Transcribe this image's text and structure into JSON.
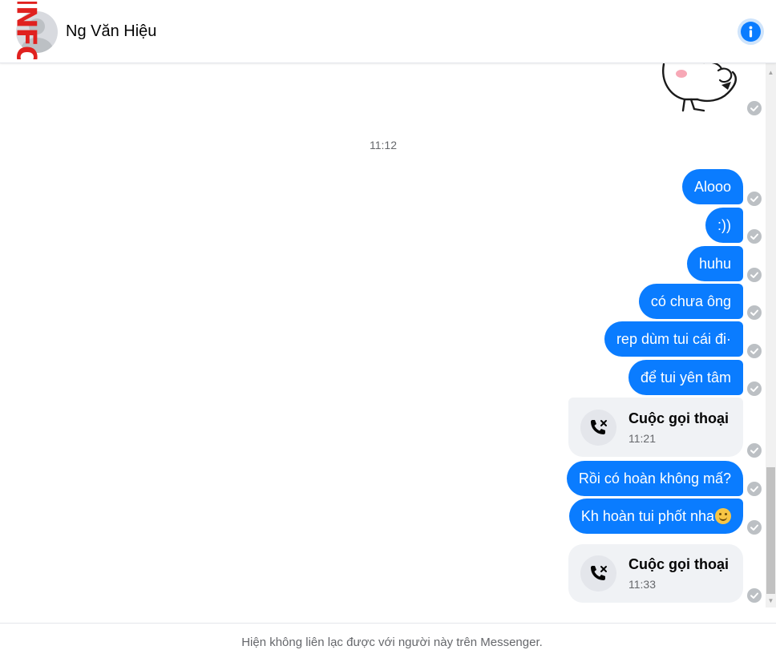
{
  "header": {
    "contact_name": "Ng Văn Hiệu",
    "watermark": "INFO",
    "info_icon": "info-icon",
    "accent_color": "#0a7cff"
  },
  "conversation": {
    "timestamp": "11:12",
    "messages": [
      {
        "type": "sticker",
        "icon": "bunny-sticker"
      },
      {
        "type": "text",
        "text": "Alooo"
      },
      {
        "type": "text",
        "text": ":))"
      },
      {
        "type": "text",
        "text": "huhu"
      },
      {
        "type": "text",
        "text": "có chưa ông"
      },
      {
        "type": "text",
        "text": "rep dùm tui cái đi·"
      },
      {
        "type": "text",
        "text": "để tui yên tâm"
      },
      {
        "type": "call",
        "title": "Cuộc gọi thoại",
        "time": "11:21",
        "icon": "missed-call-icon"
      },
      {
        "type": "text",
        "text": "Rồi có hoàn không mấ?"
      },
      {
        "type": "text",
        "text": "Kh hoàn tui phốt nha",
        "emoji": "smiley-emoji"
      },
      {
        "type": "call",
        "title": "Cuộc gọi thoại",
        "time": "11:33",
        "icon": "missed-call-icon"
      }
    ]
  },
  "footer": {
    "notice": "Hiện không liên lạc được với người này trên Messenger."
  }
}
